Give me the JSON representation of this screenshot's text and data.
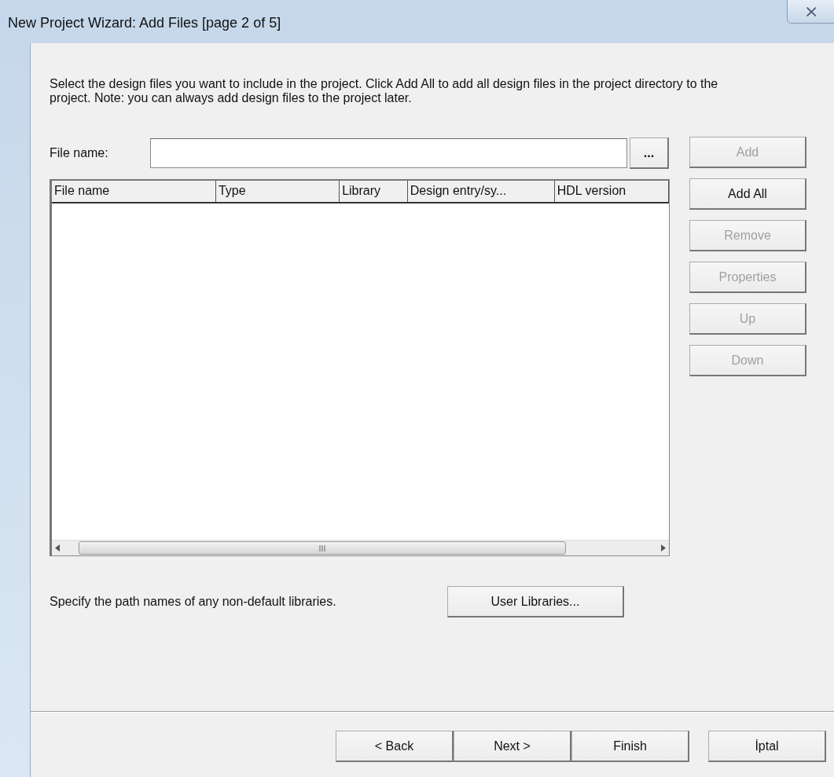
{
  "window": {
    "title": "New Project Wizard: Add Files [page 2 of 5]",
    "close": "⨯"
  },
  "description": "Select the design files you want to include in the project. Click Add All to add all design files in the project directory to the project. Note: you can always add design files to the project later.",
  "file_name": {
    "label": "File name:",
    "browse": "..."
  },
  "table": {
    "columns": [
      "File name",
      "Type",
      "Library",
      "Design entry/sy...",
      "HDL version"
    ]
  },
  "side_buttons": [
    {
      "label": "Add",
      "disabled": true
    },
    {
      "label": "Add All",
      "disabled": false
    },
    {
      "label": "Remove",
      "disabled": true
    },
    {
      "label": "Properties",
      "disabled": true
    },
    {
      "label": "Up",
      "disabled": true
    },
    {
      "label": "Down",
      "disabled": true
    }
  ],
  "libraries": {
    "text": "Specify the path names of any non-default libraries.",
    "button": "User Libraries..."
  },
  "footer_buttons": [
    "< Back",
    "Next >",
    "Finish",
    "İptal"
  ]
}
